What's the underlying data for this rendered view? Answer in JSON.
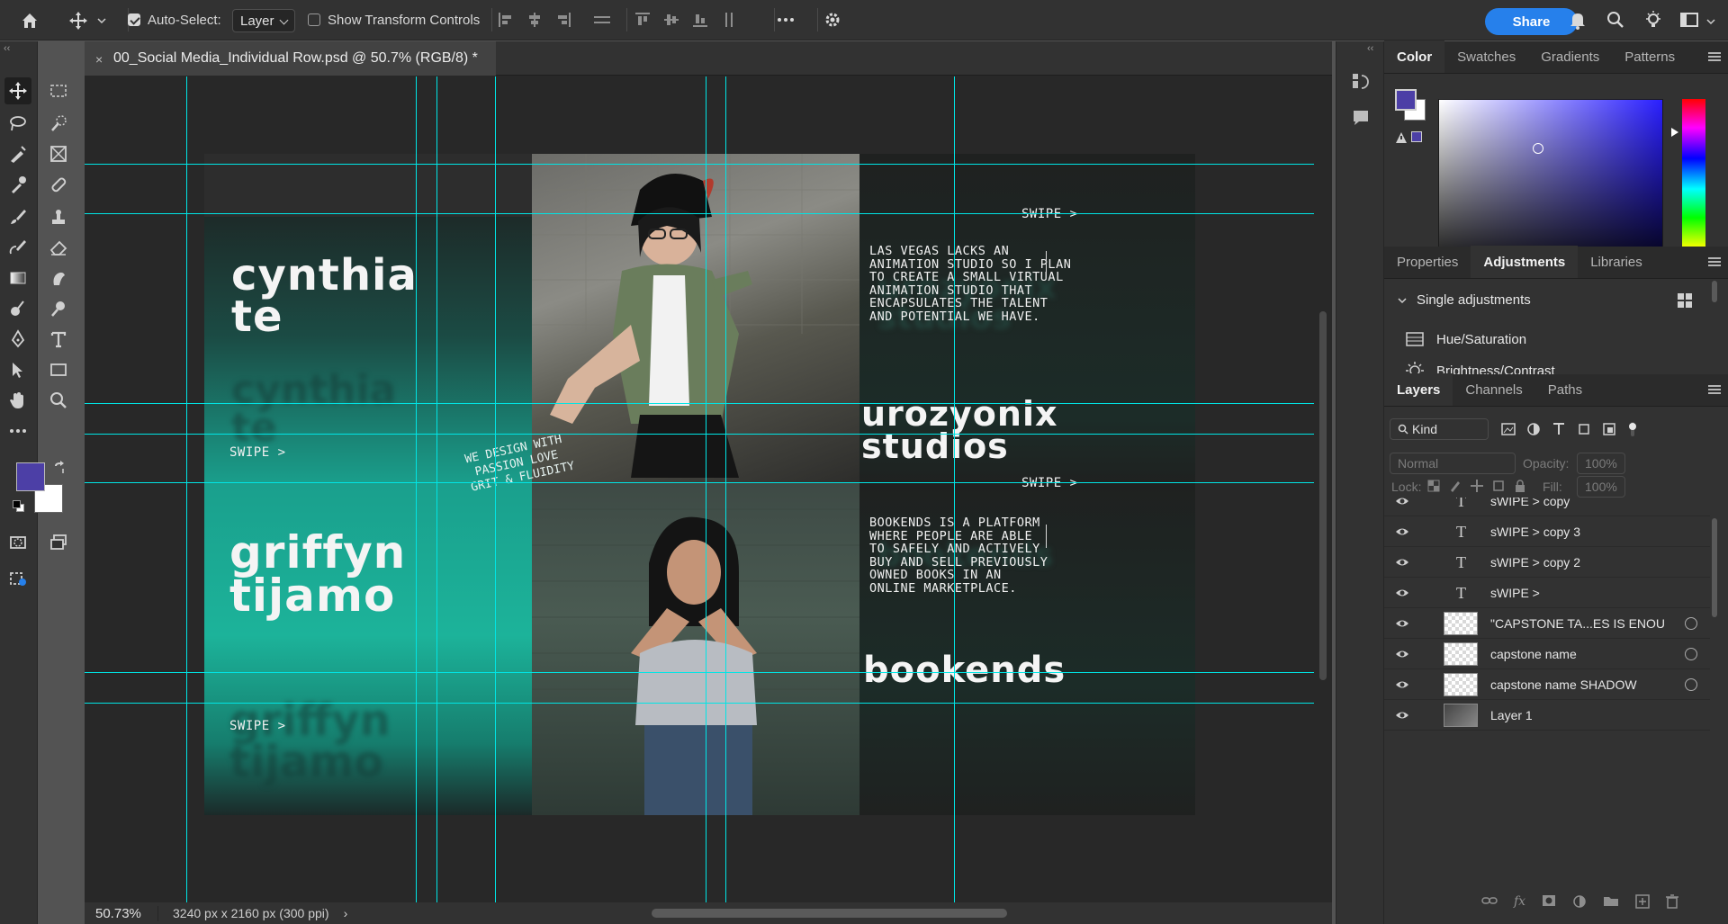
{
  "options_bar": {
    "auto_select_label": "Auto-Select:",
    "auto_select_checked": true,
    "auto_select_target": "Layer",
    "show_transform_label": "Show Transform Controls",
    "show_transform_checked": false,
    "share_label": "Share"
  },
  "document": {
    "tab_title": "00_Social Media_Individual Row.psd @ 50.7% (RGB/8) *",
    "close_glyph": "×",
    "zoom": "50.73%",
    "dimensions": "3240 px x 2160 px (300 ppi)",
    "status_arrow": "›"
  },
  "artwork": {
    "name1_line1": "cynthia",
    "name1_line2": "te",
    "name2_line1": "griffyn",
    "name2_line2": "tijamo",
    "swipe": "SWIPE >",
    "studio_line1": "urozyonix",
    "studio_line2": "studios",
    "studio_desc": "LAS VEGAS LACKS AN\nANIMATION STUDIO SO I PLAN\nTO CREATE A SMALL VIRTUAL\nANIMATION STUDIO THAT\nENCAPSULATES THE TALENT\nAND POTENTIAL WE HAVE.",
    "product_name": "bookends",
    "product_desc": "BOOKENDS IS A PLATFORM\nWHERE PEOPLE ARE ABLE\nTO SAFELY AND ACTIVELY\nBUY AND SELL PREVIOUSLY\nOWNED BOOKS IN AN\nONLINE MARKETPLACE.",
    "script_line1": "WE DESIGN WITH",
    "script_line2": "PASSION LOVE",
    "script_line3": "GRIT & FLUIDITY"
  },
  "color_panel": {
    "tabs": [
      "Color",
      "Swatches",
      "Gradients",
      "Patterns"
    ],
    "active_tab": "Color",
    "foreground": "#4c3fa6",
    "background": "#ffffff"
  },
  "properties_panel": {
    "tabs": [
      "Properties",
      "Adjustments",
      "Libraries"
    ],
    "active_tab": "Adjustments",
    "section_title": "Single adjustments",
    "items": [
      "Hue/Saturation",
      "Brightness/Contrast"
    ]
  },
  "layers_panel": {
    "tabs": [
      "Layers",
      "Channels",
      "Paths"
    ],
    "active_tab": "Layers",
    "filter_kind": "Kind",
    "blend_mode": "Normal",
    "opacity_label": "Opacity:",
    "opacity_value": "100%",
    "lock_label": "Lock:",
    "fill_label": "Fill:",
    "fill_value": "100%",
    "layers": [
      {
        "name": "sWIPE > copy",
        "type": "text"
      },
      {
        "name": "sWIPE > copy 3",
        "type": "text"
      },
      {
        "name": "sWIPE > copy 2",
        "type": "text"
      },
      {
        "name": "sWIPE >",
        "type": "text"
      },
      {
        "name": "\"CAPSTONE TA...ES IS ENOU",
        "type": "smart"
      },
      {
        "name": "capstone name",
        "type": "smart"
      },
      {
        "name": "capstone name SHADOW",
        "type": "smart"
      },
      {
        "name": "Layer 1",
        "type": "pixel"
      }
    ]
  },
  "colors": {
    "guide": "#00e5e5",
    "accent_teal": "#1cb39a",
    "share_blue": "#2680eb"
  }
}
